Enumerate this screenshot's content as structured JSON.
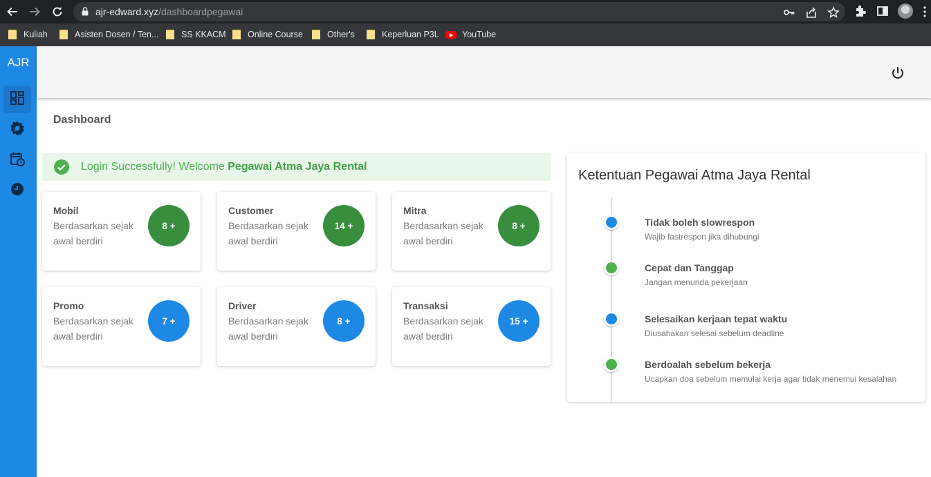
{
  "browser": {
    "url_domain": "ajr-edward.xyz",
    "url_path": "/dashboardpegawai",
    "bookmarks": [
      {
        "label": "Kuliah",
        "icon": "folder-icon"
      },
      {
        "label": "Asisten Dosen / Ten...",
        "icon": "folder-icon"
      },
      {
        "label": "SS KKACM",
        "icon": "folder-icon"
      },
      {
        "label": "Online Course",
        "icon": "folder-icon"
      },
      {
        "label": "Other's",
        "icon": "folder-icon"
      },
      {
        "label": "Keperluan P3L",
        "icon": "folder-icon"
      },
      {
        "label": "YouTube",
        "icon": "youtube-icon"
      }
    ]
  },
  "sidebar": {
    "brand": "AJR",
    "items": [
      {
        "icon": "dashboard-icon",
        "active": true
      },
      {
        "icon": "settings-badge-icon",
        "active": false
      },
      {
        "icon": "calendar-clock-icon",
        "active": false
      },
      {
        "icon": "clock-icon",
        "active": false
      }
    ]
  },
  "header": {
    "power_icon": "power-icon"
  },
  "page": {
    "title": "Dashboard"
  },
  "alert": {
    "prefix": "Login Successfully! Welcome ",
    "name": "Pegawai Atma Jaya Rental"
  },
  "cards": [
    {
      "title": "Mobil",
      "subtitle": "Berdasarkan sejak awal berdiri",
      "badge": "8 +",
      "color": "green"
    },
    {
      "title": "Customer",
      "subtitle": "Berdasarkan sejak awal berdiri",
      "badge": "14 +",
      "color": "green"
    },
    {
      "title": "Mitra",
      "subtitle": "Berdasarkan sejak awal berdiri",
      "badge": "8 +",
      "color": "green"
    },
    {
      "title": "Promo",
      "subtitle": "Berdasarkan sejak awal berdiri",
      "badge": "7 +",
      "color": "blue"
    },
    {
      "title": "Driver",
      "subtitle": "Berdasarkan sejak awal berdiri",
      "badge": "8 +",
      "color": "blue"
    },
    {
      "title": "Transaksi",
      "subtitle": "Berdasarkan sejak awal berdiri",
      "badge": "15 +",
      "color": "blue"
    }
  ],
  "rules": {
    "title": "Ketentuan Pegawai Atma Jaya Rental",
    "items": [
      {
        "title": "Tidak boleh slowrespon",
        "subtitle": "Wajib fastrespon jika dihubungi",
        "color": "blue"
      },
      {
        "title": "Cepat dan Tanggap",
        "subtitle": "Jangan menunda pekerjaan",
        "color": "green"
      },
      {
        "title": "Selesaikan kerjaan tepat waktu",
        "subtitle": "Diusahakan selesai sebelum deadline",
        "color": "blue"
      },
      {
        "title": "Berdoalah sebelum bekerja",
        "subtitle": "Ucapkan doa sebelum memulai kerja agar tidak menemui kesalahan",
        "color": "green"
      }
    ]
  },
  "colors": {
    "primary": "#1e88e5",
    "success": "#4caf50",
    "success_dark": "#388e3c",
    "alert_bg": "#e8f5e9"
  }
}
